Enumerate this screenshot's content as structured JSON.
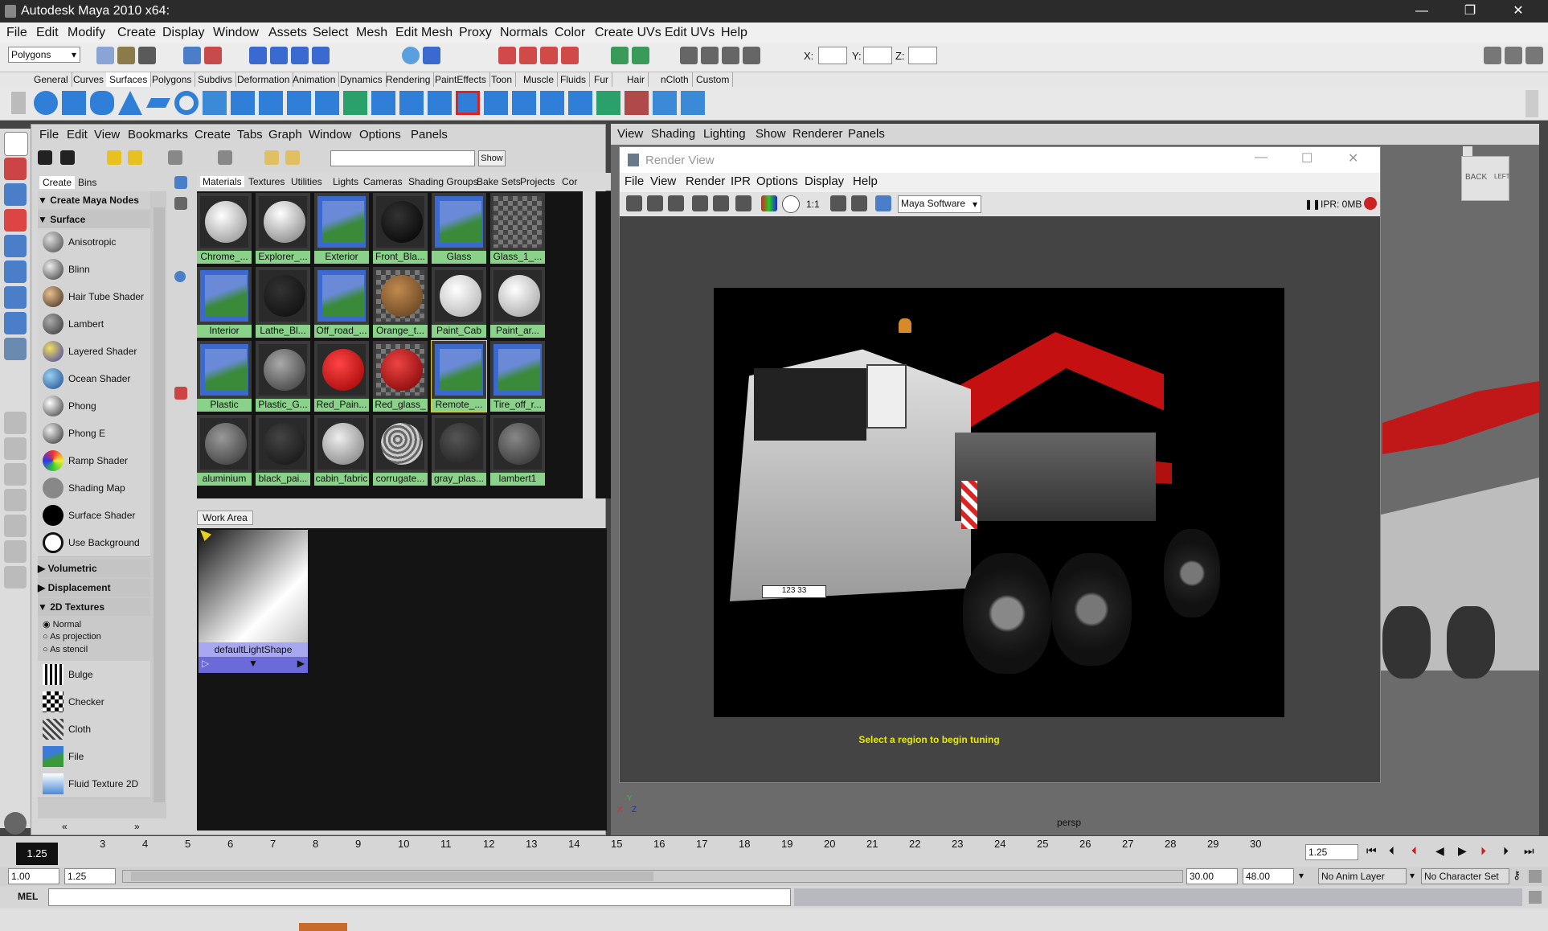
{
  "window": {
    "title": "Autodesk Maya 2010 x64:",
    "controls": [
      "—",
      "❐",
      "✕"
    ]
  },
  "main_menu": [
    "File",
    "Edit",
    "Modify",
    "Create",
    "Display",
    "Window",
    "Assets",
    "Select",
    "Mesh",
    "Edit Mesh",
    "Proxy",
    "Normals",
    "Color",
    "Create UVs",
    "Edit UVs",
    "Help"
  ],
  "status_line": {
    "menu_set": "Polygons",
    "coord_labels": [
      "X:",
      "Y:",
      "Z:"
    ]
  },
  "shelf_tabs": [
    "General",
    "Curves",
    "Surfaces",
    "Polygons",
    "Subdivs",
    "Deformation",
    "Animation",
    "Dynamics",
    "Rendering",
    "PaintEffects",
    "Toon",
    "Muscle",
    "Fluids",
    "Fur",
    "Hair",
    "nCloth",
    "Custom"
  ],
  "shelf_active": "Surfaces",
  "hypershade": {
    "menu": [
      "File",
      "Edit",
      "View",
      "Bookmarks",
      "Create",
      "Tabs",
      "Graph",
      "Window",
      "Options",
      "Panels"
    ],
    "show_button": "Show",
    "create_tabs": [
      "Create",
      "Bins"
    ],
    "create_header": "Create Maya Nodes",
    "sections": {
      "surface": "Surface",
      "volumetric": "Volumetric",
      "displacement": "Displacement",
      "textures2d": "2D Textures"
    },
    "surface_nodes": [
      "Anisotropic",
      "Blinn",
      "Hair Tube Shader",
      "Lambert",
      "Layered Shader",
      "Ocean Shader",
      "Phong",
      "Phong E",
      "Ramp Shader",
      "Shading Map",
      "Surface Shader",
      "Use Background"
    ],
    "texture_modes": [
      "Normal",
      "As projection",
      "As stencil"
    ],
    "texture_nodes": [
      "Bulge",
      "Checker",
      "Cloth",
      "File",
      "Fluid Texture 2D"
    ],
    "nav_arrows": [
      "«",
      "»"
    ],
    "tabs": [
      "Materials",
      "Textures",
      "Utilities",
      "Lights",
      "Cameras",
      "Shading Groups",
      "Bake Sets",
      "Projects",
      "Cor"
    ],
    "materials": [
      "Chrome_...",
      "Explorer_...",
      "Exterior",
      "Front_Bla...",
      "Glass",
      "Glass_1_...",
      "Interior",
      "Lathe_Bl...",
      "Off_road_...",
      "Orange_t...",
      "Paint_Cab",
      "Paint_ar...",
      "Plastic",
      "Plastic_G...",
      "Red_Pain...",
      "Red_glass_",
      "Remote_...",
      "Tire_off_r...",
      "aluminium",
      "black_pai...",
      "cabin_fabric",
      "corrugate...",
      "gray_plas...",
      "lambert1"
    ],
    "work_area_tab": "Work Area",
    "work_node": "defaultLightShape"
  },
  "viewport": {
    "menu": [
      "View",
      "Shading",
      "Lighting",
      "Show",
      "Renderer",
      "Panels"
    ],
    "camera": "persp",
    "viewcube": [
      "BACK",
      "LEFT"
    ],
    "axis": [
      "Y",
      "X",
      "Z"
    ]
  },
  "render_view": {
    "title": "Render View",
    "menu": [
      "File",
      "View",
      "Render",
      "IPR",
      "Options",
      "Display",
      "Help"
    ],
    "renderer": "Maya Software",
    "ratio": "1:1",
    "ipr_status": "IPR: 0MB",
    "status": "Select a region to begin tuning",
    "plate": "123 33"
  },
  "time_slider": {
    "current": "1.25",
    "ticks": [
      "3",
      "4",
      "5",
      "6",
      "7",
      "8",
      "9",
      "10",
      "11",
      "12",
      "13",
      "14",
      "15",
      "16",
      "17",
      "18",
      "19",
      "20",
      "21",
      "22",
      "23",
      "24",
      "25",
      "26",
      "27",
      "28",
      "29",
      "30"
    ],
    "current_field": "1.25"
  },
  "range_slider": {
    "start": "1.00",
    "current": "1.25",
    "end_range": "30.00",
    "end_total": "48.00",
    "anim_layer": "No Anim Layer",
    "character_set": "No Character Set"
  },
  "command_line": {
    "label": "MEL"
  },
  "colors": {
    "material_label_bg": "#8ad18a",
    "render_status": "#e8e800",
    "truck_red": "#cc1111"
  }
}
